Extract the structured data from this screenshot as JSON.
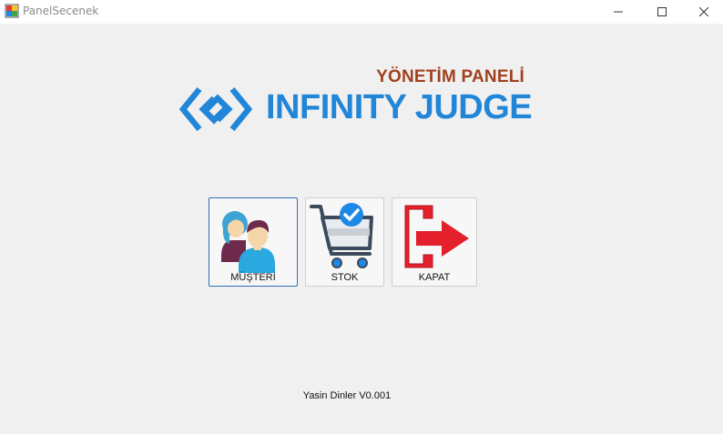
{
  "window": {
    "title": "PanelSecenek",
    "controls": [
      "minimize-icon",
      "maximize-icon",
      "close-icon"
    ]
  },
  "header": {
    "subtitle": "YÖNETİM PANELİ",
    "brand": "INFINITY JUDGE"
  },
  "menu": {
    "buttons": [
      {
        "label": "MÜŞTERİ",
        "icon": "customers-icon"
      },
      {
        "label": "STOK",
        "icon": "stock-cart-icon"
      },
      {
        "label": "KAPAT",
        "icon": "exit-icon"
      }
    ]
  },
  "footer": {
    "text": "Yasin Dinler V0.001"
  },
  "colors": {
    "subtitle": "#a0401f",
    "brand": "#2186d8",
    "exit_red": "#e3202c",
    "active_border": "#2d6fb5"
  }
}
